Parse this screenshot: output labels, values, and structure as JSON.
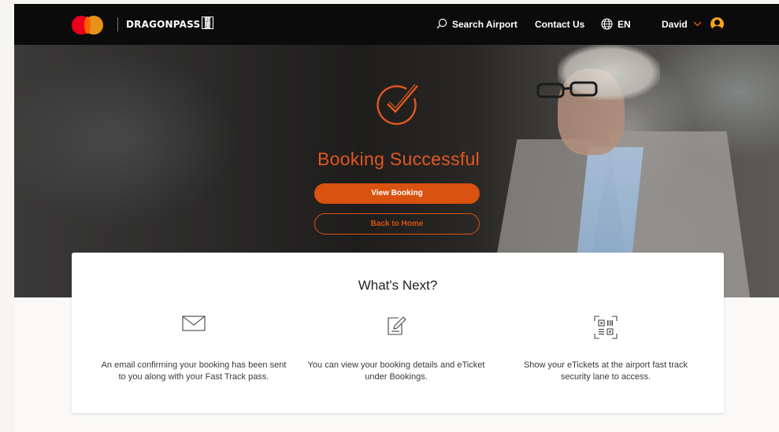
{
  "header": {
    "brand": "DRAGONPASS",
    "brand_badge": "龍騰",
    "search_label": "Search Airport",
    "contact_label": "Contact Us",
    "language_label": "EN",
    "user_name": "David"
  },
  "hero": {
    "title": "Booking Successful",
    "view_booking_label": "View Booking",
    "back_home_label": "Back to Home"
  },
  "next": {
    "title": "What's Next?",
    "steps": [
      {
        "icon": "envelope-icon",
        "text": "An email confirming your booking has been sent to you along with your Fast Track pass."
      },
      {
        "icon": "edit-document-icon",
        "text": "You can view your booking details and eTicket under Bookings."
      },
      {
        "icon": "qr-code-icon",
        "text": "Show your eTickets at the airport fast track security lane to access."
      }
    ]
  },
  "colors": {
    "accent": "#d9520f",
    "header_bg": "#0b0b0b",
    "avatar": "#f7a21b"
  }
}
